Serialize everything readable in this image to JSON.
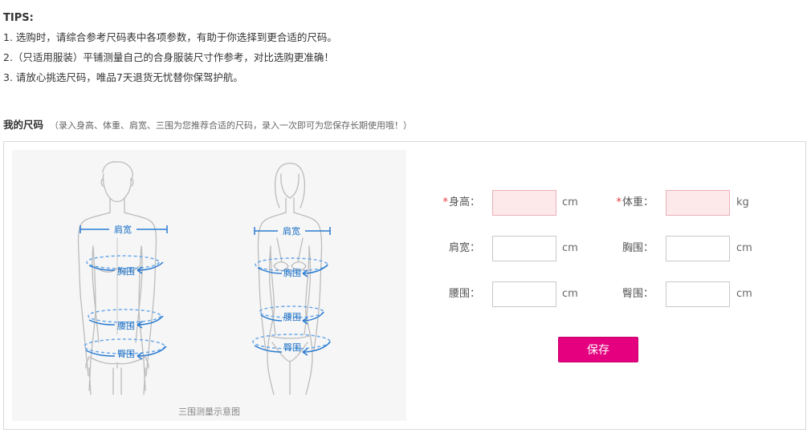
{
  "tips": {
    "title": "TIPS:",
    "lines": [
      "1. 选购时，请综合参考尺码表中各项参数，有助于你选择到更合适的尺码。",
      "2.（只适用服装）平铺测量自己的合身服装尺寸作参考，对比选购更准确！",
      "3. 请放心挑选尺码，唯品7天退货无忧替你保驾护航。"
    ]
  },
  "size_section": {
    "title": "我的尺码",
    "hint": "（录入身高、体重、肩宽、三围为您推荐合适的尺码，录入一次即可为您保存长期使用哦！）"
  },
  "figure": {
    "caption": "三围测量示意图",
    "male_labels": {
      "shoulder": "肩宽",
      "chest": "胸围",
      "waist": "腰围",
      "hip": "臀围"
    },
    "female_labels": {
      "shoulder": "肩宽",
      "chest": "胸围",
      "waist": "腰围",
      "hip": "臀围"
    },
    "line_color": "#2a7bd1"
  },
  "form": {
    "required_mark": "*",
    "height": {
      "label": "身高：",
      "value": "",
      "unit": "cm",
      "required": true
    },
    "weight": {
      "label": "体重：",
      "value": "",
      "unit": "kg",
      "required": true
    },
    "shoulder": {
      "label": "肩宽：",
      "value": "",
      "unit": "cm",
      "required": false
    },
    "chest": {
      "label": "胸围：",
      "value": "",
      "unit": "cm",
      "required": false
    },
    "waist": {
      "label": "腰围：",
      "value": "",
      "unit": "cm",
      "required": false
    },
    "hip": {
      "label": "臀围：",
      "value": "",
      "unit": "cm",
      "required": false
    },
    "save_label": "保存"
  },
  "colors": {
    "required_input_bg": "#fde8ea",
    "save_button_bg": "#e4007f",
    "required_mark": "#e4393c"
  }
}
